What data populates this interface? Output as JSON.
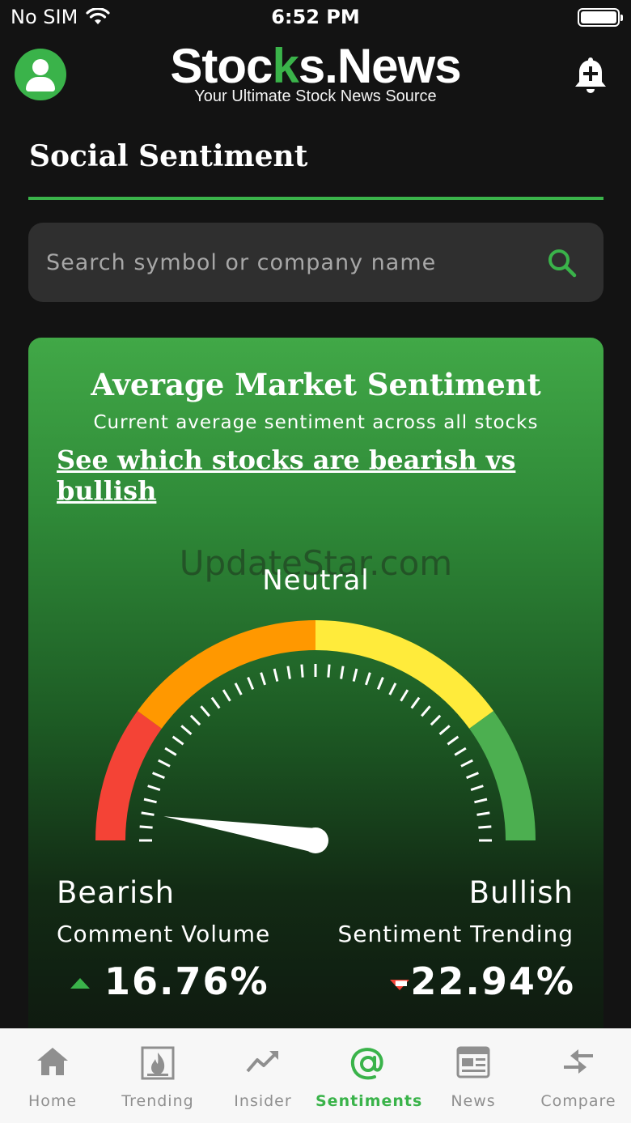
{
  "status_bar": {
    "carrier": "No SIM",
    "time": "6:52 PM"
  },
  "header": {
    "logo_part1": "Stoc",
    "logo_k": "k",
    "logo_part2": "s.News",
    "tagline": "Your Ultimate Stock News Source"
  },
  "page": {
    "title": "Social Sentiment"
  },
  "search": {
    "placeholder": "Search symbol or company name",
    "value": ""
  },
  "card": {
    "title": "Average Market Sentiment",
    "subtitle": "Current average sentiment across all stocks",
    "link": "See which stocks are bearish vs bullish",
    "watermark": "UpdateStar.com",
    "gauge_label": "Neutral",
    "gauge_value_fraction": 0.05,
    "left_label": "Bearish",
    "right_label": "Bullish",
    "left_metric_label": "Comment Volume",
    "right_metric_label": "Sentiment Trending",
    "left_metric_value": "16.76%",
    "right_metric_value": "-22.94%"
  },
  "colors": {
    "accent": "#3ab34a",
    "gauge_red": "#f44336",
    "gauge_orange": "#ff9800",
    "gauge_yellow": "#ffeb3b",
    "gauge_green": "#4caf50"
  },
  "tabs": [
    {
      "label": "Home",
      "icon": "home-icon",
      "active": false
    },
    {
      "label": "Trending",
      "icon": "fire-icon",
      "active": false
    },
    {
      "label": "Insider",
      "icon": "trend-line-icon",
      "active": false
    },
    {
      "label": "Sentiments",
      "icon": "at-sign-icon",
      "active": true
    },
    {
      "label": "News",
      "icon": "newspaper-icon",
      "active": false
    },
    {
      "label": "Compare",
      "icon": "compare-arrows-icon",
      "active": false
    }
  ]
}
